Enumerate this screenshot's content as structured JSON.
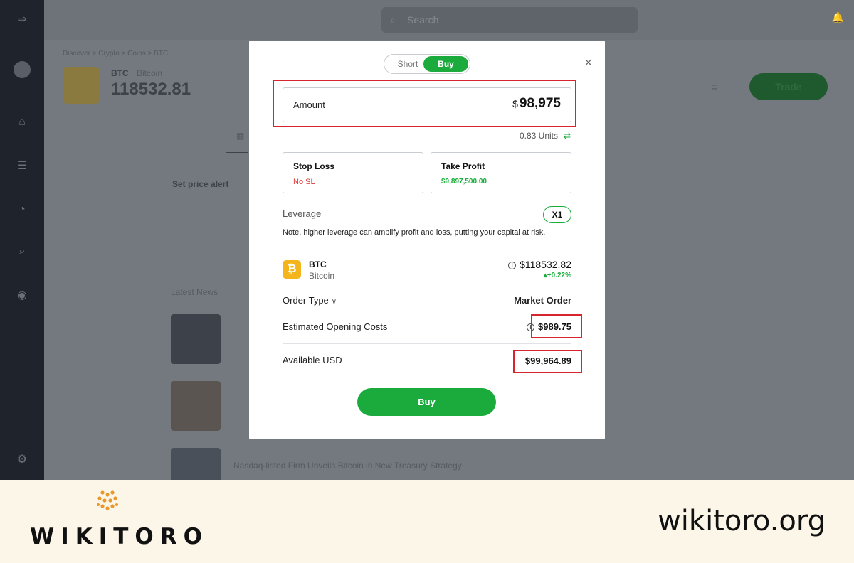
{
  "background": {
    "search_placeholder": "Search",
    "breadcrumb": "Discover  >  Crypto  >  Coins  >  BTC",
    "asset_symbol": "BTC",
    "asset_name": "Bitcoin",
    "asset_price": "118532.81",
    "trade_label": "Trade",
    "price_alerts": "Set price alert",
    "latest_news": "Latest News",
    "news_headline": "Nasdaq-listed Firm Unveils Bitcoin in New Treasury Strategy"
  },
  "modal": {
    "toggle_short": "Short",
    "toggle_buy": "Buy",
    "close_glyph": "×",
    "amount": {
      "label": "Amount",
      "currency": "$",
      "value": "98,975"
    },
    "units_text": "0.83 Units",
    "swap_glyph": "⇄",
    "stop_loss": {
      "title": "Stop Loss",
      "value": "No SL",
      "color": "#e03434"
    },
    "take_profit": {
      "title": "Take Profit",
      "value": "$9,897,500.00",
      "color": "#1aab3c"
    },
    "leverage": {
      "label": "Leverage",
      "value": "X1",
      "note": "Note, higher leverage can amplify profit and loss, putting your capital at risk."
    },
    "coin": {
      "symbol": "BTC",
      "name": "Bitcoin",
      "icon_glyph": "₿",
      "price": "$118532.82",
      "change": "+0.22%"
    },
    "order_type": {
      "label": "Order Type",
      "value": "Market Order"
    },
    "opening_costs": {
      "label": "Estimated Opening Costs",
      "value": "$989.75"
    },
    "available": {
      "label": "Available USD",
      "value": "$99,964.89"
    },
    "buy_label": "Buy"
  },
  "footer": {
    "logo_text": "WIKITORO",
    "site_url": "wikitoro.org"
  },
  "colors": {
    "accent_green": "#1aab3c",
    "highlight_red": "#d6252d",
    "footer_bg": "#fcf6e8",
    "logo_orange": "#e8982d"
  }
}
